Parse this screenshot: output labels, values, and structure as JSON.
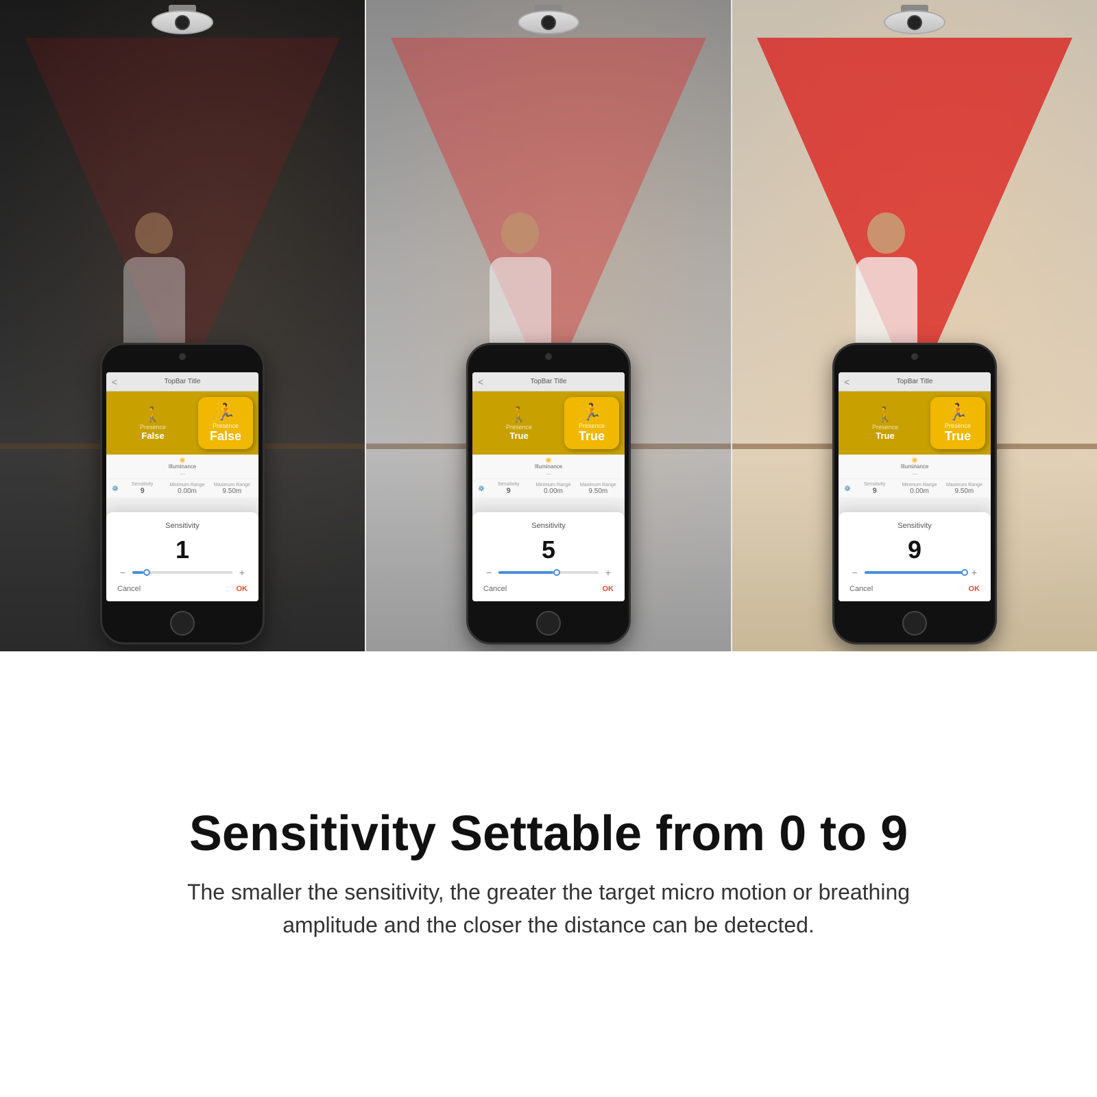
{
  "panels": [
    {
      "id": "panel-1",
      "brightness": "dim",
      "presence_label": "Presence",
      "presence_value": "False",
      "presence_badge_value": "False",
      "sensitivity_title": "Sensitivity",
      "sensitivity_value": "1",
      "slider_percent": 11,
      "topbar_title": "TopBar Title",
      "luminance_label": "Illuminance",
      "luminance_value": "...",
      "sensitivity_label": "Sensitivity",
      "sensitivity_small": "9",
      "min_range_label": "Minimum Range",
      "min_range_value": "0.00m",
      "max_range_label": "Maximum Range",
      "max_range_value": "9.50m",
      "cancel_label": "Cancel",
      "ok_label": "OK",
      "beam_opacity": 0.25
    },
    {
      "id": "panel-2",
      "brightness": "medium",
      "presence_label": "Presence",
      "presence_value": "True",
      "presence_badge_value": "True",
      "sensitivity_title": "Sensitivity",
      "sensitivity_value": "5",
      "slider_percent": 55,
      "topbar_title": "TopBar Title",
      "luminance_label": "Illuminance",
      "luminance_value": "...",
      "sensitivity_label": "Sensitivity",
      "sensitivity_small": "9",
      "min_range_label": "Minimum Range",
      "min_range_value": "0.00m",
      "max_range_label": "Maximum Range",
      "max_range_value": "9.50m",
      "cancel_label": "Cancel",
      "ok_label": "OK",
      "beam_opacity": 0.5
    },
    {
      "id": "panel-3",
      "brightness": "bright",
      "presence_label": "Presence",
      "presence_value": "True",
      "presence_badge_value": "True",
      "sensitivity_title": "Sensitivity",
      "sensitivity_value": "9",
      "slider_percent": 100,
      "topbar_title": "TopBar Title",
      "luminance_label": "Illuminance",
      "luminance_value": "...",
      "sensitivity_label": "Sensitivity",
      "sensitivity_small": "9",
      "min_range_label": "Minimum Range",
      "min_range_value": "0.00m",
      "max_range_label": "Maximum Range",
      "max_range_value": "9.50m",
      "cancel_label": "Cancel",
      "ok_label": "OK",
      "beam_opacity": 0.75
    }
  ],
  "bottom": {
    "headline": "Sensitivity Settable from 0 to 9",
    "subtext": "The smaller the sensitivity, the greater the target micro motion or breathing amplitude and the closer the distance can be detected."
  }
}
